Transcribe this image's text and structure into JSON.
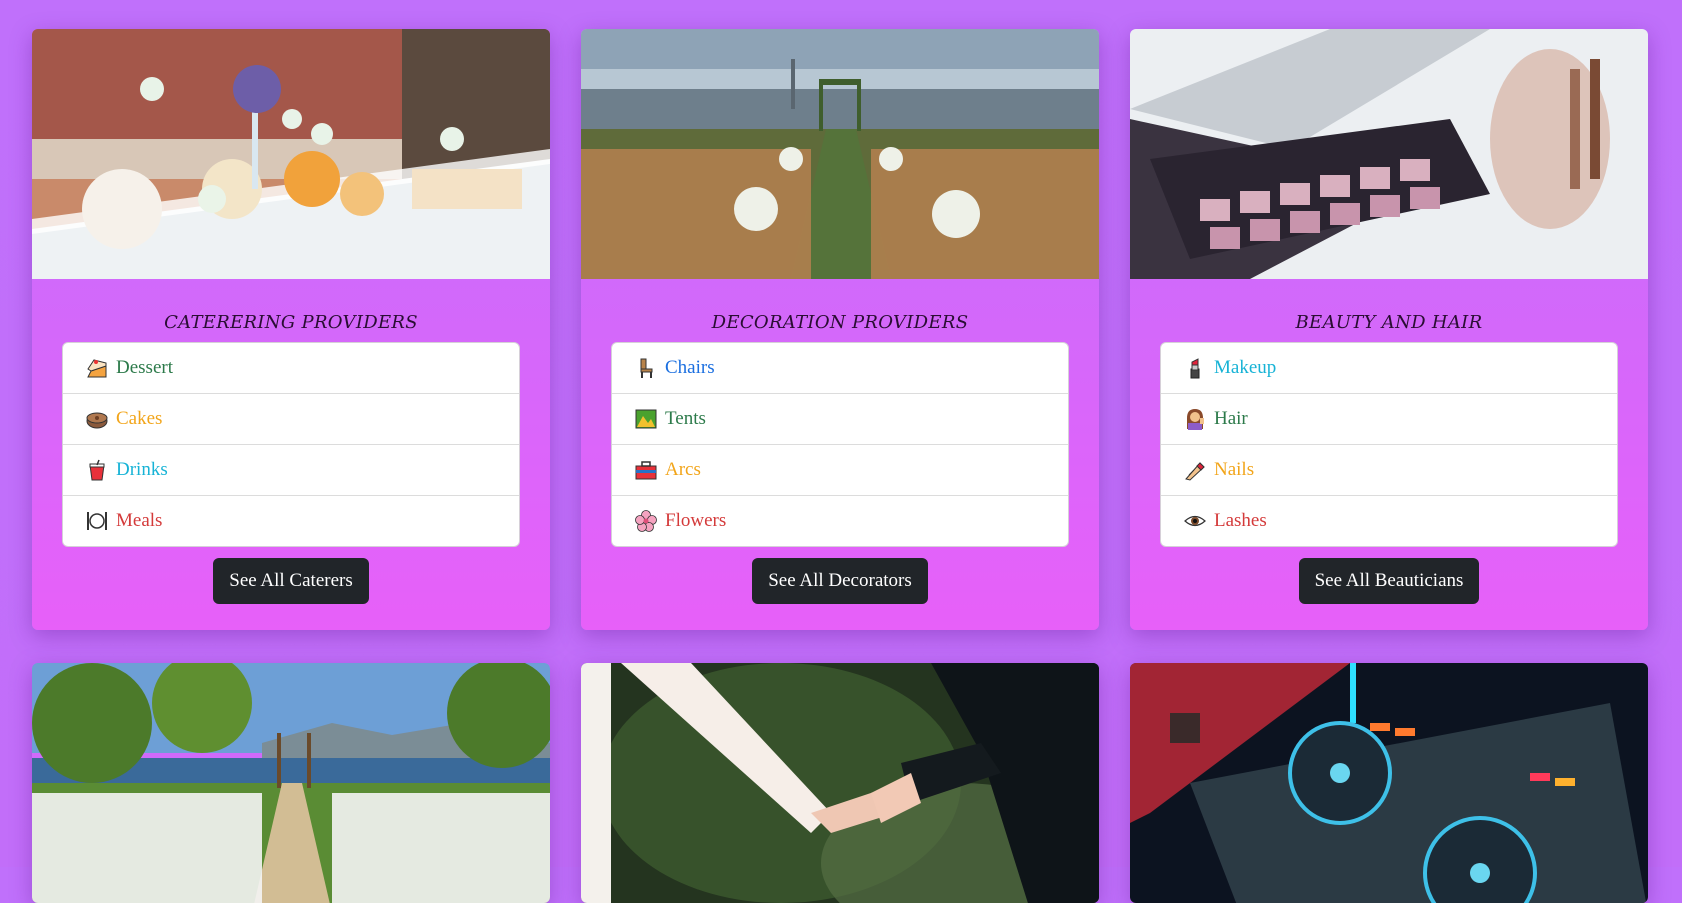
{
  "cards": [
    {
      "title": "CATERERING PROVIDERS",
      "items": [
        {
          "label": "Dessert",
          "color": "#2c7a4a",
          "icon": "cake-icon"
        },
        {
          "label": "Cakes",
          "color": "#f2a51a",
          "icon": "mooncake-icon"
        },
        {
          "label": "Drinks",
          "color": "#17b3d6",
          "icon": "drink-cup-icon"
        },
        {
          "label": "Meals",
          "color": "#d43a3a",
          "icon": "plate-cutlery-icon"
        }
      ],
      "button": "See All Caterers",
      "image": "dessert-table-photo"
    },
    {
      "title": "DECORATION PROVIDERS",
      "items": [
        {
          "label": "Chairs",
          "color": "#1b6fe0",
          "icon": "chair-icon"
        },
        {
          "label": "Tents",
          "color": "#2c7a4a",
          "icon": "national-park-icon"
        },
        {
          "label": "Arcs",
          "color": "#f2a51a",
          "icon": "toolbox-icon"
        },
        {
          "label": "Flowers",
          "color": "#d43a3a",
          "icon": "cherry-blossom-icon"
        }
      ],
      "button": "See All Decorators",
      "image": "rooftop-ceremony-photo"
    },
    {
      "title": "BEAUTY AND HAIR",
      "items": [
        {
          "label": "Makeup",
          "color": "#17b3d6",
          "icon": "lipstick-icon"
        },
        {
          "label": "Hair",
          "color": "#2c7a4a",
          "icon": "woman-tipping-hand-icon"
        },
        {
          "label": "Nails",
          "color": "#f2a51a",
          "icon": "nail-polish-icon"
        },
        {
          "label": "Lashes",
          "color": "#d43a3a",
          "icon": "eye-icon"
        }
      ],
      "button": "See All Beauticians",
      "image": "makeup-palette-photo"
    }
  ],
  "bottom_cards": [
    {
      "image": "lakeside-ceremony-photo"
    },
    {
      "image": "holding-hands-photo"
    },
    {
      "image": "dj-controller-photo"
    }
  ]
}
